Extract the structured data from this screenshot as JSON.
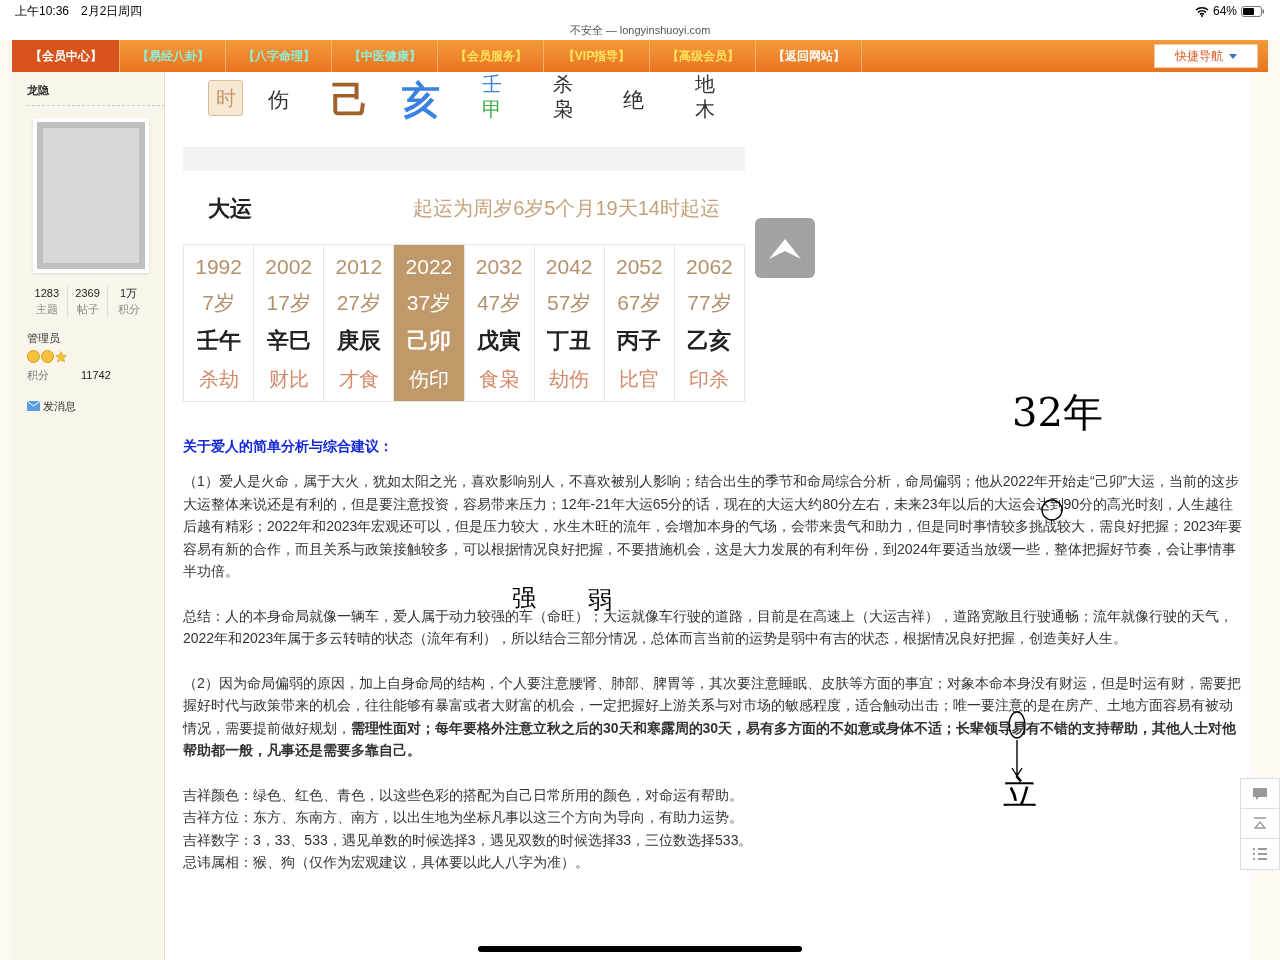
{
  "status_bar": {
    "time": "上午10:36",
    "date": "2月2日周四",
    "battery": "64%"
  },
  "browser": {
    "address": "不安全 — longyinshuoyi.com"
  },
  "nav": {
    "items": [
      {
        "label": "【会员中心】",
        "selected": true,
        "kind": "plain"
      },
      {
        "label": "【易经八卦】",
        "selected": false,
        "kind": "topic"
      },
      {
        "label": "【八字命理】",
        "selected": false,
        "kind": "topic"
      },
      {
        "label": "【中医健康】",
        "selected": false,
        "kind": "topic"
      },
      {
        "label": "【会员服务】",
        "selected": false,
        "kind": "member"
      },
      {
        "label": "【VIP指导】",
        "selected": false,
        "kind": "member"
      },
      {
        "label": "【高级会员】",
        "selected": false,
        "kind": "member"
      },
      {
        "label": "【返回网站】",
        "selected": false,
        "kind": "plain"
      }
    ],
    "quick_nav": "快捷导航"
  },
  "sidebar": {
    "username": "龙隐",
    "stats": [
      {
        "value": "1283",
        "label": "主题"
      },
      {
        "value": "2369",
        "label": "帖子"
      },
      {
        "value": "1万",
        "label": "积分"
      }
    ],
    "group": "管理员",
    "points_label": "积分",
    "points": "11742",
    "message": "发消息"
  },
  "pillar_row": [
    {
      "kind": "badge",
      "lines": [
        {
          "text": "时",
          "color": "#c49a6c"
        }
      ]
    },
    {
      "kind": "text",
      "lines": [
        {
          "text": "伤",
          "color": "#333333"
        }
      ]
    },
    {
      "kind": "big",
      "lines": [
        {
          "text": "己",
          "color": "#a0622a"
        }
      ]
    },
    {
      "kind": "big",
      "lines": [
        {
          "text": "亥",
          "color": "#3b82e0"
        }
      ]
    },
    {
      "kind": "stack",
      "lines": [
        {
          "text": "壬",
          "color": "#3b82e0"
        },
        {
          "text": "甲",
          "color": "#3fae4a"
        }
      ]
    },
    {
      "kind": "stack",
      "lines": [
        {
          "text": "杀",
          "color": "#333333"
        },
        {
          "text": "枭",
          "color": "#333333"
        }
      ]
    },
    {
      "kind": "text",
      "lines": [
        {
          "text": "绝",
          "color": "#333333"
        }
      ]
    },
    {
      "kind": "stack",
      "lines": [
        {
          "text": "地",
          "color": "#333333"
        },
        {
          "text": "木",
          "color": "#333333"
        }
      ]
    }
  ],
  "dayun": {
    "title": "大运",
    "note": "起运为周岁6岁5个月19天14时起运",
    "columns": [
      {
        "year": "1992",
        "age": "7岁",
        "ganzhi": "壬午",
        "gods": "杀劫",
        "selected": false
      },
      {
        "year": "2002",
        "age": "17岁",
        "ganzhi": "辛巳",
        "gods": "财比",
        "selected": false
      },
      {
        "year": "2012",
        "age": "27岁",
        "ganzhi": "庚辰",
        "gods": "才食",
        "selected": false
      },
      {
        "year": "2022",
        "age": "37岁",
        "ganzhi": "己卯",
        "gods": "伤印",
        "selected": true
      },
      {
        "year": "2032",
        "age": "47岁",
        "ganzhi": "戊寅",
        "gods": "食枭",
        "selected": false
      },
      {
        "year": "2042",
        "age": "57岁",
        "ganzhi": "丁丑",
        "gods": "劫伤",
        "selected": false
      },
      {
        "year": "2052",
        "age": "67岁",
        "ganzhi": "丙子",
        "gods": "比官",
        "selected": false
      },
      {
        "year": "2062",
        "age": "77岁",
        "ganzhi": "乙亥",
        "gods": "印杀",
        "selected": false
      }
    ]
  },
  "analysis": {
    "heading": "关于爱人的简单分析与综合建议：",
    "paragraphs": [
      [
        "（1）爱人是火命，属于大火，犹如太阳之光，喜欢影响别人，不喜欢被别人影响；结合出生的季节和命局综合分析，命局偏弱；他从2022年开始走“己卯”大运，当前的这步大运整体来说还是有利的，但是要注意投资，容易带来压力；12年-21年大运65分的话，现在的大运大约80分左右，未来23年以后的大运会达到90分的高光时刻，人生越往后越有精彩；2022年和2023年宏观还可以，但是压力较大，水生木旺的流年，会增加本身的气场，会带来贵气和助力，但是同时事情较多挑战较大，需良好把握；2023年要容易有新的合作，而且关系与政策接触较多，可以根据情况良好把握，不要措施机会，这是大力发展的有利年份，到2024年要适当放缓一些，整体把握好节奏，会让事情事半功倍。"
      ],
      [
        "总结：人的本身命局就像一辆车，爱人属于动力较强的车（命旺）；大运就像车行驶的道路，目前是在高速上（大运吉祥），道路宽敞且行驶通畅；流年就像行驶的天气，2022年和2023年属于多云转晴的状态（流年有利），所以结合三部分情况，总体而言当前的运势是弱中有吉的状态，根据情况良好把握，创造美好人生。"
      ],
      [
        "（2）因为命局偏弱的原因，加上自身命局的结构，个人要注意腰肾、肺部、脾胃等，其次要注意睡眠、皮肤等方面的事宜；对象本命本身没有财运，但是时运有财，需要把握好时代与政策带来的机会，往往能够有暴富或者大财富的机会，一定把握好上游关系与对市场的敏感程度，适合触动出击；唯一要注意的是在房产、土地方面容易有被动情况，需要提前做好规划，**需理性面对；每年要格外注意立秋之后的30天和寒露周的30天，易有多方面的不如意或身体不适；长辈领导易有不错的支持帮助，其他人士对他帮助都一般，凡事还是需要多靠自己。**"
      ],
      [
        "吉祥颜色：绿色、红色、青色，以这些色彩的搭配为自己日常所用的颜色，对命运有帮助。",
        "吉祥方位：东方、东南方、南方，以出生地为坐标凡事以这三个方向为导向，有助力运势。",
        "吉祥数字：3，33、533，遇见单数的时候选择3，遇见双数的时候选择33，三位数选择533。",
        "忌讳属相：猴、狗（仅作为宏观建议，具体要以此人八字为准）。"
      ]
    ]
  },
  "handwriting": [
    "32年",
    "强",
    "弱",
    "立"
  ]
}
